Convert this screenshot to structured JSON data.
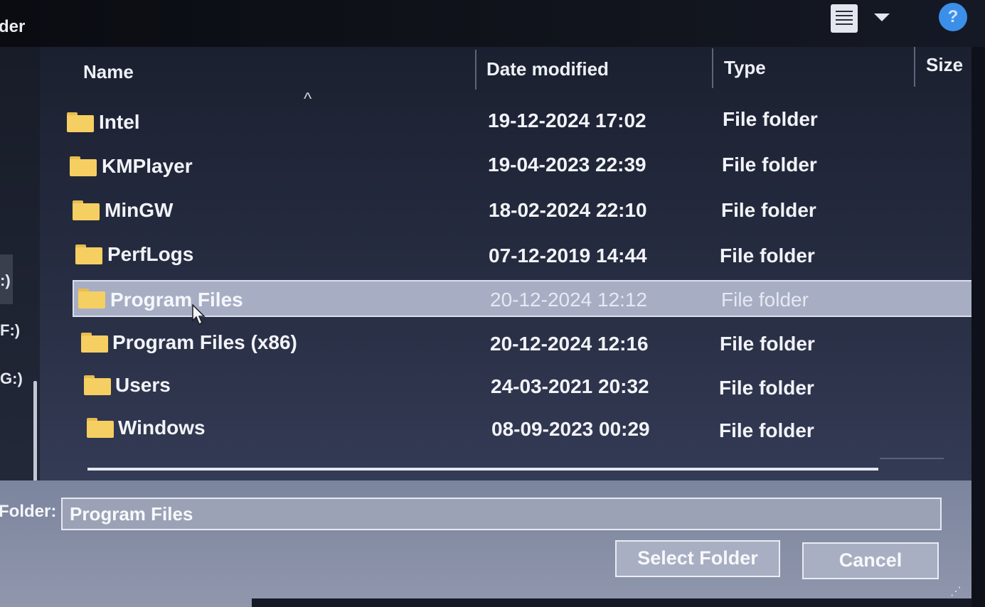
{
  "window": {
    "title_fragment": "der"
  },
  "toolbar": {
    "view_icon": "details-view-icon",
    "help_icon": "help-icon",
    "help_glyph": "?"
  },
  "nav": {
    "drives": [
      ":)",
      "F:)",
      "G:)"
    ]
  },
  "columns": {
    "name": "Name",
    "date": "Date modified",
    "type": "Type",
    "size": "Size",
    "sort_glyph": "^"
  },
  "rows": [
    {
      "name": "Intel",
      "date": "19-12-2024 17:02",
      "type": "File folder"
    },
    {
      "name": "KMPlayer",
      "date": "19-04-2023 22:39",
      "type": "File folder"
    },
    {
      "name": "MinGW",
      "date": "18-02-2024 22:10",
      "type": "File folder"
    },
    {
      "name": "PerfLogs",
      "date": "07-12-2019 14:44",
      "type": "File folder"
    },
    {
      "name": "Program Files",
      "date": "20-12-2024 12:12",
      "type": "File folder",
      "selected": true
    },
    {
      "name": "Program Files (x86)",
      "date": "20-12-2024 12:16",
      "type": "File folder"
    },
    {
      "name": "Users",
      "date": "24-03-2021 20:32",
      "type": "File folder"
    },
    {
      "name": "Windows",
      "date": "08-09-2023 00:29",
      "type": "File folder"
    }
  ],
  "footer": {
    "folder_label": "Folder:",
    "folder_value": "Program Files",
    "select_button": "Select Folder",
    "cancel_button": "Cancel"
  },
  "colors": {
    "folder": "#f5cf62",
    "selection": "#a7aec4",
    "help": "#3b8fe8"
  }
}
